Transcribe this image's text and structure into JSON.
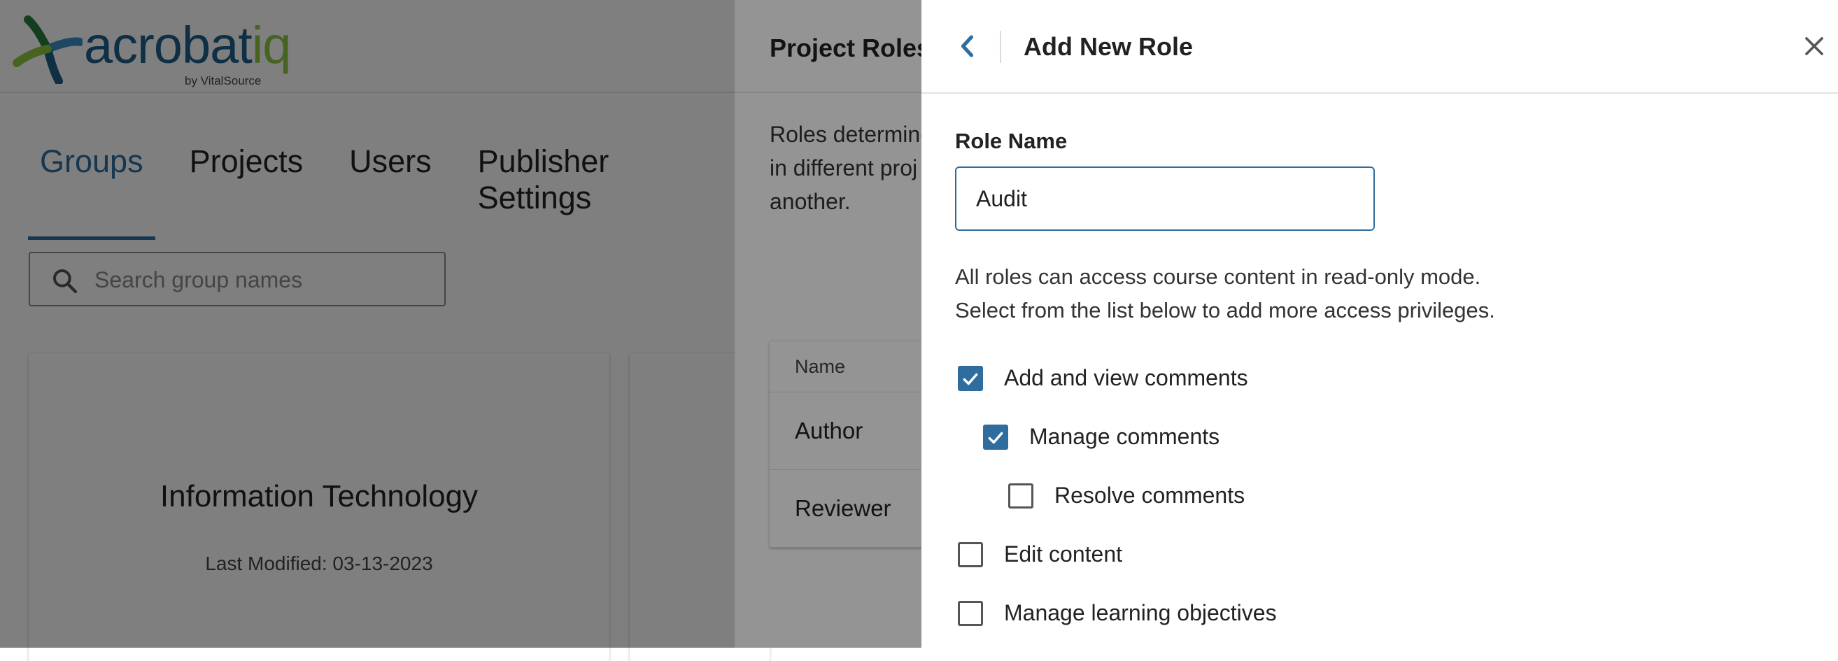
{
  "app": {
    "logo_text_main": "acrobat",
    "logo_text_accent": "iq",
    "logo_byline": "by VitalSource"
  },
  "nav": {
    "tabs": [
      {
        "label": "Groups",
        "active": true
      },
      {
        "label": "Projects",
        "active": false
      },
      {
        "label": "Users",
        "active": false
      },
      {
        "label": "Publisher Settings",
        "active": false
      }
    ]
  },
  "search": {
    "placeholder": "Search group names",
    "icon": "search-icon"
  },
  "cards": [
    {
      "title": "Information Technology",
      "meta": "Last Modified: 03-13-2023"
    }
  ],
  "project_roles": {
    "title": "Project Roles",
    "description_lines": [
      "Roles determine",
      "in different proj",
      "another."
    ],
    "table": {
      "header": "Name",
      "rows": [
        "Author",
        "Reviewer"
      ]
    }
  },
  "drawer": {
    "title": "Add New Role",
    "back_icon": "chevron-left-icon",
    "close_icon": "close-icon",
    "role_name_label": "Role Name",
    "role_name_value": "Audit",
    "info_line_1": "All roles can access course content in read-only mode.",
    "info_line_2": "Select from the list below to add more access privileges.",
    "permissions": [
      {
        "label": "Add and view comments",
        "checked": true,
        "level": 0
      },
      {
        "label": "Manage comments",
        "checked": true,
        "level": 1
      },
      {
        "label": "Resolve comments",
        "checked": false,
        "level": 2
      },
      {
        "label": "Edit content",
        "checked": false,
        "level": 0
      },
      {
        "label": "Manage learning objectives",
        "checked": false,
        "level": 0
      }
    ]
  },
  "colors": {
    "accent": "#2e6d9e",
    "logo_blue": "#1f5f8b",
    "logo_green": "#8cc63e"
  }
}
